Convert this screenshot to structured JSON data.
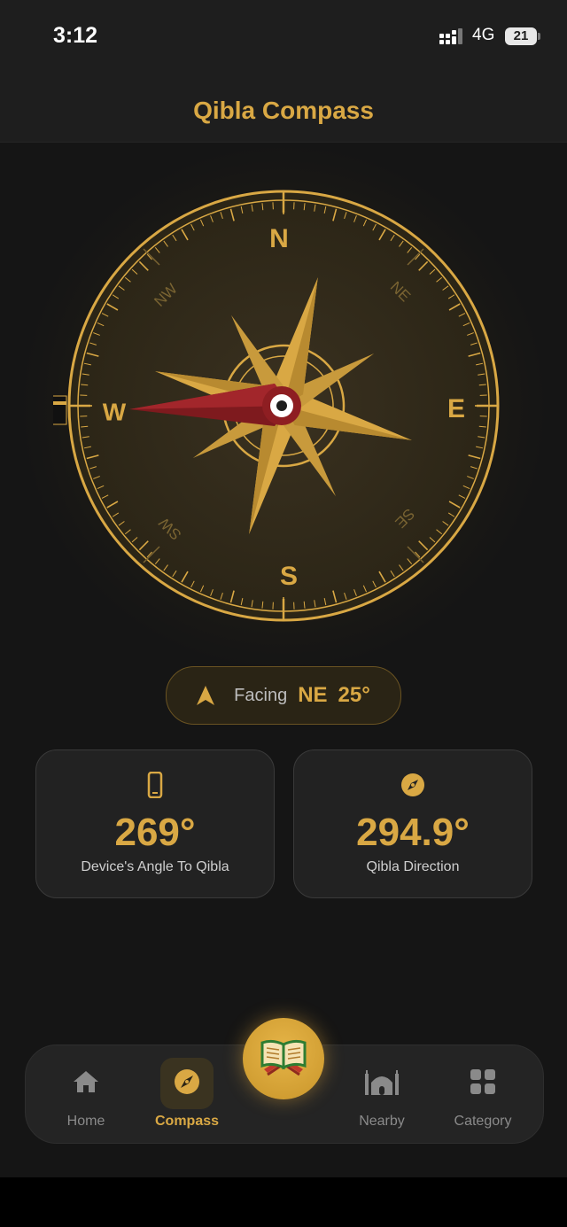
{
  "status_bar": {
    "time": "3:12",
    "network": "4G",
    "battery": "21"
  },
  "header": {
    "title": "Qibla Compass"
  },
  "compass": {
    "cardinals": {
      "n": "N",
      "e": "E",
      "s": "S",
      "w": "W"
    },
    "intercardinals": {
      "ne": "NE",
      "se": "SE",
      "sw": "SW",
      "nw": "NW"
    }
  },
  "facing": {
    "label": "Facing",
    "direction": "NE",
    "degrees": "25°"
  },
  "cards": [
    {
      "icon": "phone-icon",
      "value": "269°",
      "label": "Device's Angle To Qibla"
    },
    {
      "icon": "compass-icon",
      "value": "294.9°",
      "label": "Qibla Direction"
    }
  ],
  "nav": {
    "items": [
      {
        "icon": "home-icon",
        "label": "Home"
      },
      {
        "icon": "compass-icon",
        "label": "Compass"
      },
      {
        "icon": "quran-icon",
        "label": ""
      },
      {
        "icon": "mosque-icon",
        "label": "Nearby"
      },
      {
        "icon": "grid-icon",
        "label": "Category"
      }
    ],
    "active": "Compass"
  },
  "colors": {
    "accent": "#d9a844",
    "background": "#151515",
    "needle": "#8e1e22"
  }
}
